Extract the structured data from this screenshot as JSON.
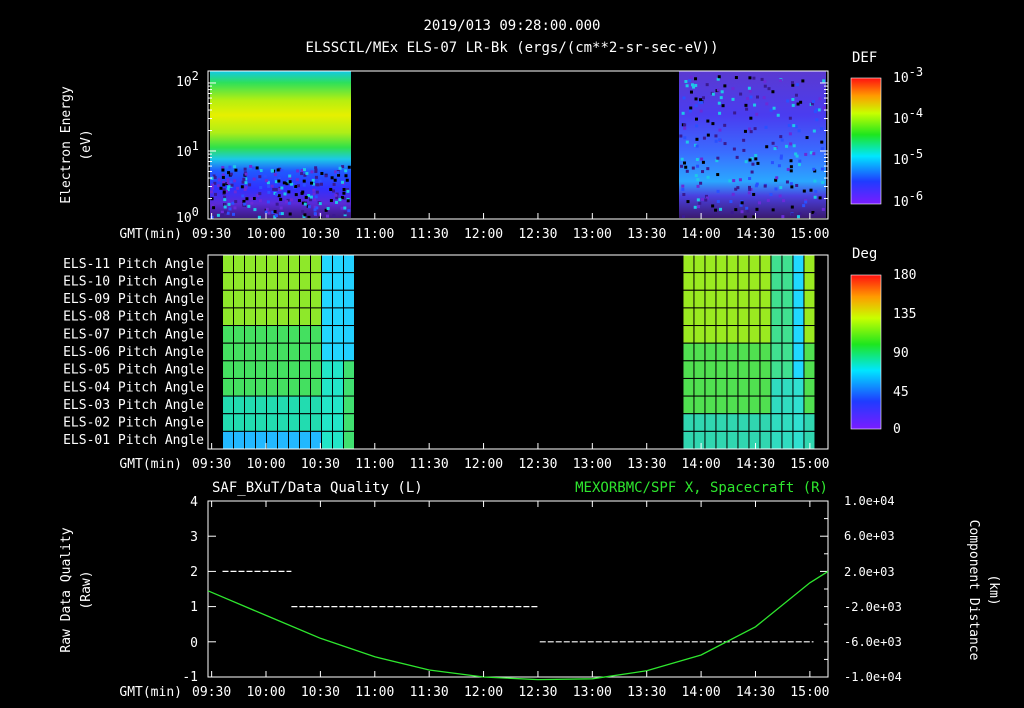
{
  "header": {
    "timestamp": "2019/013 09:28:00.000",
    "subtitle": "ELSSCIL/MEx ELS-07 LR-Bk  (ergs/(cm**2-sr-sec-eV))"
  },
  "colors": {
    "background": "#000000",
    "text": "#ffffff",
    "series_green": "#2ee62e"
  },
  "panel1": {
    "ylabel_line1": "Electron Energy",
    "ylabel_line2": "(eV)",
    "yticks": [
      "10",
      "10",
      "10"
    ],
    "yticks_exp": [
      "2",
      "1",
      "0"
    ],
    "colorbar_title": "DEF",
    "colorbar_ticks": [
      "10",
      "10",
      "10",
      "10"
    ],
    "colorbar_exp": [
      "-3",
      "-4",
      "-5",
      "-6"
    ]
  },
  "panel2": {
    "rows": [
      "ELS-11 Pitch Angle",
      "ELS-10 Pitch Angle",
      "ELS-09 Pitch Angle",
      "ELS-08 Pitch Angle",
      "ELS-07 Pitch Angle",
      "ELS-06 Pitch Angle",
      "ELS-05 Pitch Angle",
      "ELS-04 Pitch Angle",
      "ELS-03 Pitch Angle",
      "ELS-02 Pitch Angle",
      "ELS-01 Pitch Angle"
    ],
    "colorbar_title": "Deg",
    "colorbar_ticks": [
      "180",
      "135",
      "90",
      "45",
      "0"
    ]
  },
  "panel3": {
    "left_title": "SAF_BXuT/Data Quality (L)",
    "right_title": "MEXORBMC/SPF X, Spacecraft (R)",
    "ylabel_left_line1": "Raw Data Quality",
    "ylabel_left_line2": "(Raw)",
    "ylabel_right_line1": "Component Distance",
    "ylabel_right_line2": "(km)",
    "left_ticks": [
      "4",
      "3",
      "2",
      "1",
      "0",
      "-1"
    ],
    "right_ticks": [
      "1.0e+04",
      "6.0e+03",
      "2.0e+03",
      "-2.0e+03",
      "-6.0e+03",
      "-1.0e+04"
    ]
  },
  "time_axis": {
    "label": "GMT(min)",
    "ticks": [
      "09:30",
      "10:00",
      "10:30",
      "11:00",
      "11:30",
      "12:00",
      "12:30",
      "13:00",
      "13:30",
      "14:00",
      "14:30",
      "15:00"
    ]
  },
  "chart_data": [
    {
      "type": "heatmap",
      "x_range": [
        "09:28",
        "15:10"
      ],
      "y_scale": "log",
      "ylim": [
        1,
        150
      ],
      "data_intervals": [
        [
          "09:28",
          "10:47"
        ],
        [
          "13:50",
          "15:10"
        ]
      ],
      "peak_energy_band_eV": [
        15,
        60
      ],
      "colorbar_range": [
        1e-06,
        0.001
      ]
    },
    {
      "type": "heatmap",
      "x_range": [
        "09:28",
        "15:10"
      ],
      "rows": 11,
      "data_intervals": [
        [
          "09:36",
          "10:47"
        ],
        [
          "13:50",
          "15:05"
        ]
      ],
      "colorbar_range": [
        0,
        180
      ]
    },
    {
      "type": "line",
      "series": [
        {
          "name": "SAF_BXuT/Data Quality",
          "axis": "left",
          "segments": [
            {
              "x": [
                "09:36",
                "10:14"
              ],
              "y": 2
            },
            {
              "x": [
                "10:14",
                "12:30"
              ],
              "y": 1
            },
            {
              "x": [
                "12:31",
                "15:02"
              ],
              "y": 0
            }
          ]
        },
        {
          "name": "MEXORBMC/SPF X, Spacecraft",
          "axis": "right",
          "x": [
            "09:28",
            "10:00",
            "10:30",
            "11:00",
            "11:30",
            "12:00",
            "12:30",
            "13:00",
            "13:30",
            "14:00",
            "14:30",
            "15:00",
            "15:10"
          ],
          "y": [
            -200,
            -3000,
            -5600,
            -7700,
            -9200,
            -10000,
            -10300,
            -10200,
            -9300,
            -7500,
            -4300,
            700,
            2000
          ]
        }
      ],
      "ylim_left": [
        -1,
        4
      ],
      "ylim_right": [
        -10000,
        10000
      ]
    }
  ]
}
